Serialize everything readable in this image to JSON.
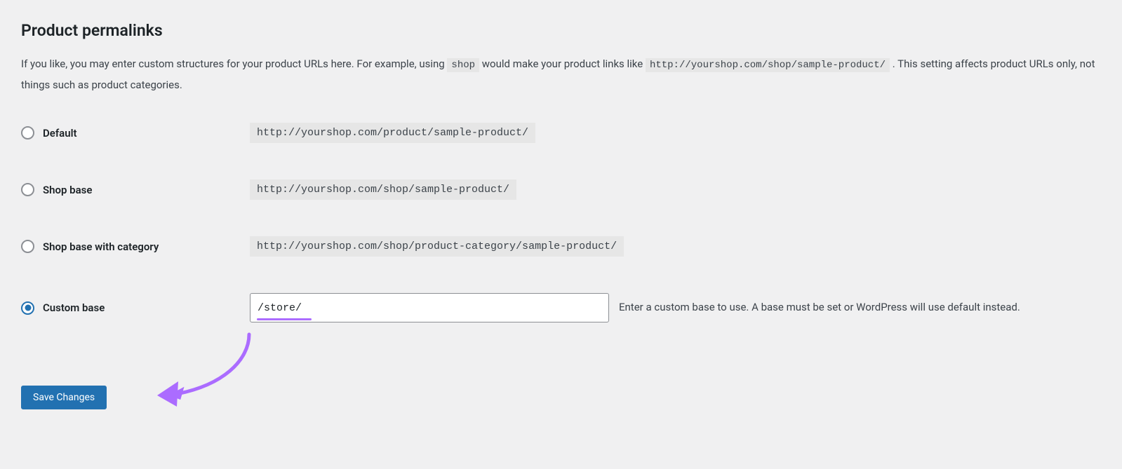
{
  "section_title": "Product permalinks",
  "description": {
    "prefix": "If you like, you may enter custom structures for your product URLs here. For example, using ",
    "code1": "shop",
    "mid": " would make your product links like ",
    "code2": "http://yourshop.com/shop/sample-product/",
    "suffix": " . This setting affects product URLs only, not things such as product categories."
  },
  "options": [
    {
      "label": "Default",
      "example": "http://yourshop.com/product/sample-product/",
      "checked": false
    },
    {
      "label": "Shop base",
      "example": "http://yourshop.com/shop/sample-product/",
      "checked": false
    },
    {
      "label": "Shop base with category",
      "example": "http://yourshop.com/shop/product-category/sample-product/",
      "checked": false
    }
  ],
  "custom": {
    "label": "Custom base",
    "value": "/store/",
    "helper": "Enter a custom base to use. A base must be set or WordPress will use default instead.",
    "checked": true
  },
  "save_label": "Save Changes"
}
